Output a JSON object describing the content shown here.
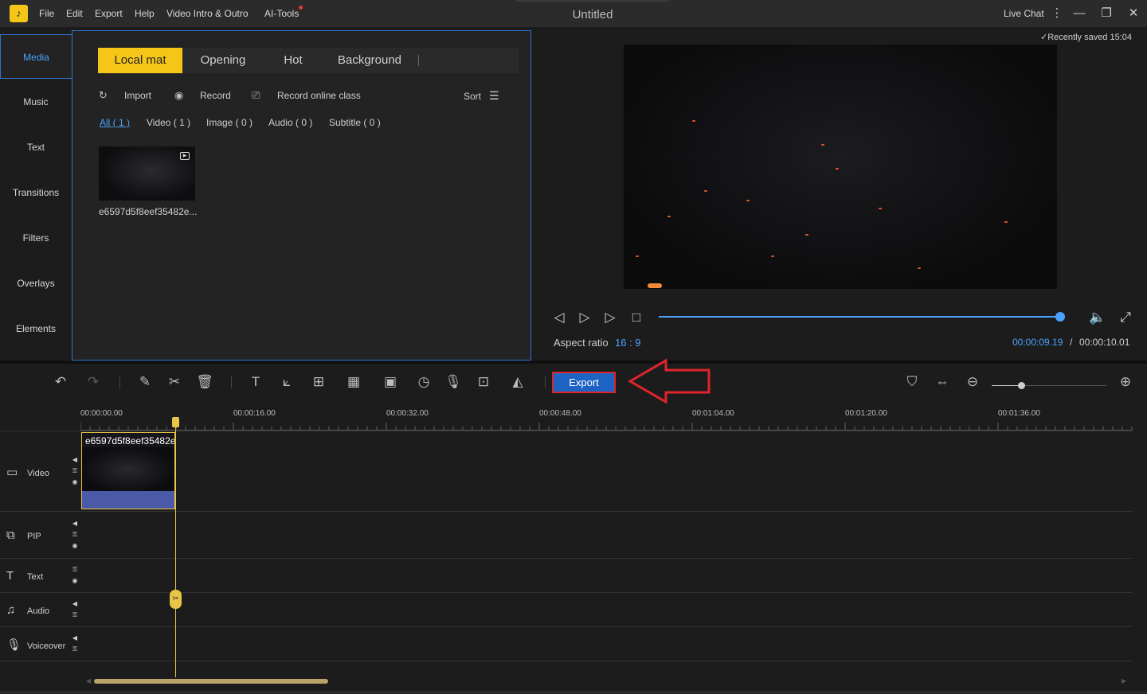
{
  "app": {
    "title": "Untitled",
    "logo_icon": "app-logo-icon",
    "menu": [
      "File",
      "Edit",
      "Export",
      "Help",
      "Video Intro & Outro",
      "AI-Tools"
    ],
    "live_chat": "Live Chat",
    "window_controls": [
      "more-icon",
      "minimize-icon",
      "restore-icon",
      "close-icon"
    ]
  },
  "sidebar": {
    "items": [
      "Media",
      "Music",
      "Text",
      "Transitions",
      "Filters",
      "Overlays",
      "Elements"
    ],
    "active": "Media"
  },
  "media": {
    "tabs": [
      "Local mat",
      "Opening",
      "Hot",
      "Background"
    ],
    "active_tab": "Local mat",
    "actions": {
      "import": "Import",
      "record": "Record",
      "record_online": "Record online class"
    },
    "sort_label": "Sort",
    "filters": [
      "All ( 1 )",
      "Video ( 1 )",
      "Image ( 0 )",
      "Audio ( 0 )",
      "Subtitle ( 0 )"
    ],
    "active_filter": "All ( 1 )",
    "items": [
      {
        "name": "e6597d5f8eef35482e..."
      }
    ]
  },
  "preview": {
    "saved_status": "Recently saved 15:04",
    "progress": 0.998,
    "aspect_label": "Aspect ratio",
    "aspect_value": "16 : 9",
    "current_time": "00:00:09.19",
    "time_separator": "/",
    "total_time": "00:00:10.01"
  },
  "toolbar": {
    "export_label": "Export",
    "zoom_level": 0.26,
    "tools": [
      "undo-icon",
      "redo-icon",
      "edit-icon",
      "split-icon",
      "delete-icon",
      "text-icon",
      "crop-icon",
      "resize-icon",
      "mosaic-icon",
      "freeze-frame-icon",
      "duration-icon",
      "voiceover-icon",
      "screen-record-icon",
      "color-pick-icon"
    ]
  },
  "timeline": {
    "ruler": [
      "00:00:00.00",
      "00:00:16.00",
      "00:00:32.00",
      "00:00:48.00",
      "00:01:04.00",
      "00:01:20.00",
      "00:01:36.00"
    ],
    "tracks": [
      "Video",
      "PIP",
      "Text",
      "Audio",
      "Voiceover"
    ],
    "clip_name": "e6597d5f8eef35482e"
  },
  "colors": {
    "accent_yellow": "#f5c518",
    "accent_blue": "#4aa3ff",
    "export_blue": "#1e63c4",
    "highlight_red": "#e0242b"
  }
}
